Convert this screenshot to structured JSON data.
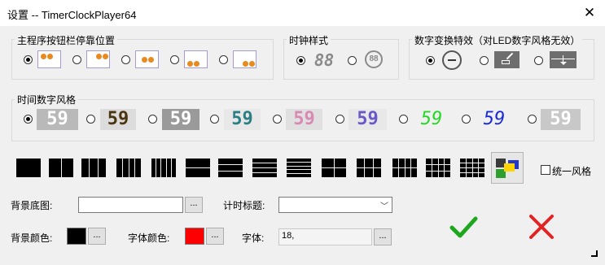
{
  "window": {
    "title": "设置 -- TimerClockPlayer64",
    "close_glyph": "✕"
  },
  "layout_group": {
    "label": "主程序按钮栏停靠位置",
    "options": [
      "top-left",
      "top-right",
      "bottom-center",
      "bottom-left",
      "bottom-right"
    ],
    "selected_index": 0
  },
  "clock_group": {
    "label": "时钟样式",
    "options": [
      "digital-88",
      "round-88"
    ],
    "selected_index": 0,
    "digital_text": "88",
    "round_text": "88"
  },
  "transition_group": {
    "label": "数字变换特效（对LED数字风格无效）",
    "options": [
      "none",
      "flip",
      "slide-down"
    ],
    "selected_index": 0
  },
  "font_style_group": {
    "label": "时间数字风格",
    "selected_index": 0,
    "samples": [
      {
        "text": "59",
        "color": "#ffffff",
        "bg": "#b9b9b9"
      },
      {
        "text": "59",
        "color": "#4a3510",
        "bg": "#dcdcdc"
      },
      {
        "text": "59",
        "color": "#ffffff",
        "bg": "#9a9a9a"
      },
      {
        "text": "59",
        "color": "#2a7f86",
        "bg": "#e8e8e8"
      },
      {
        "text": "59",
        "color": "#d98ab3",
        "bg": "#e0e0e0"
      },
      {
        "text": "59",
        "color": "#6a58c9",
        "bg": "#e8e8e8"
      },
      {
        "text": "59",
        "color": "#23d823",
        "bg": "#f0f0f0"
      },
      {
        "text": "59",
        "color": "#1a2ad8",
        "bg": "#f0f0f0"
      },
      {
        "text": "59",
        "color": "#ffffff",
        "bg": "#c8c8c8"
      }
    ]
  },
  "grid_layouts": {
    "selected_index": 14,
    "unify_label": "统一风格",
    "unify_checked": false
  },
  "background_image": {
    "label": "背景底图:",
    "value": "",
    "browse": "..."
  },
  "timer_title": {
    "label": "计时标题:",
    "value": ""
  },
  "background_color": {
    "label": "背景颜色:",
    "color": "#000000",
    "browse": "..."
  },
  "font_color": {
    "label": "字体颜色:",
    "color": "#ff0000",
    "browse": "..."
  },
  "font": {
    "label": "字体:",
    "value": "18,",
    "browse": "..."
  },
  "actions": {
    "ok_color": "#1fa61f",
    "cancel_color": "#e02424"
  }
}
